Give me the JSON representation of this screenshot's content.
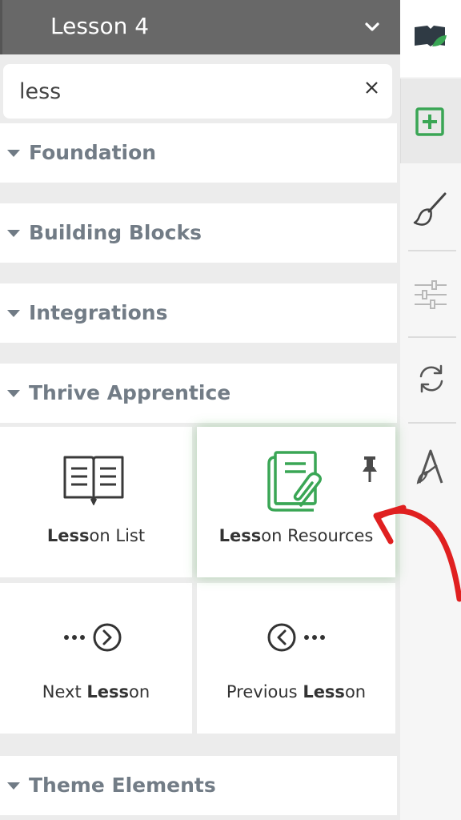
{
  "header": {
    "title": "Lesson 4"
  },
  "search": {
    "value": "less"
  },
  "sections": {
    "foundation": "Foundation",
    "building_blocks": "Building Blocks",
    "integrations": "Integrations",
    "thrive_apprentice": "Thrive Apprentice",
    "theme_elements": "Theme Elements"
  },
  "tiles": [
    {
      "match": "Less",
      "rest": "on List"
    },
    {
      "match": "Less",
      "rest": "on Resources"
    },
    {
      "prefix": "Next ",
      "match": "Less",
      "rest": "on"
    },
    {
      "prefix": "Previous ",
      "match": "Less",
      "rest": "on"
    }
  ],
  "sidebar_icons": [
    "book-leaf-icon",
    "add-element-icon",
    "brush-icon",
    "sliders-icon",
    "refresh-icon",
    "thrive-logo-icon"
  ],
  "colors": {
    "accent_green": "#3aa655",
    "annotation_red": "#e02020",
    "header_bg": "#686868"
  }
}
